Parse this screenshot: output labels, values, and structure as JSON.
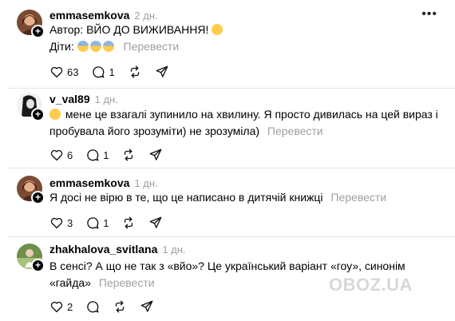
{
  "comments": [
    {
      "username": "emmasemkova",
      "time": "2 дн.",
      "line1": "Автор: ВЙО ДО ВИЖИВАННЯ!",
      "line2": "Діти:",
      "translate": "Перевести",
      "likes": "63",
      "replies": "1",
      "reposts": "",
      "shares": ""
    },
    {
      "username": "v_val89",
      "time": "1 дн.",
      "line1": "мене це взагалі зупинило на хвилину. Я просто дивилась на цей вираз і",
      "line2": "пробувала його зрозуміти) не зрозуміла)",
      "translate": "Перевести",
      "likes": "6",
      "replies": "1",
      "reposts": "",
      "shares": ""
    },
    {
      "username": "emmasemkova",
      "time": "1 дн.",
      "line1": "Я досі не вірю в те, що це написано в дитячій книжці",
      "translate": "Перевести",
      "likes": "3",
      "replies": "1",
      "reposts": "",
      "shares": ""
    },
    {
      "username": "zhakhalova_svitlana",
      "time": "1 дн.",
      "line1": "В сенсі? А що не так з «вйо»? Це український варіант «гоу», синонім",
      "line2": "«гайда»",
      "translate": "Перевести",
      "likes": "2",
      "replies": "",
      "reposts": "",
      "shares": ""
    }
  ],
  "watermark": "OBOZ.UA",
  "icons": {
    "like": "heart-icon",
    "reply": "comment-bubble-icon",
    "repost": "repost-icon",
    "share": "paper-plane-icon",
    "more": "more-icon"
  }
}
